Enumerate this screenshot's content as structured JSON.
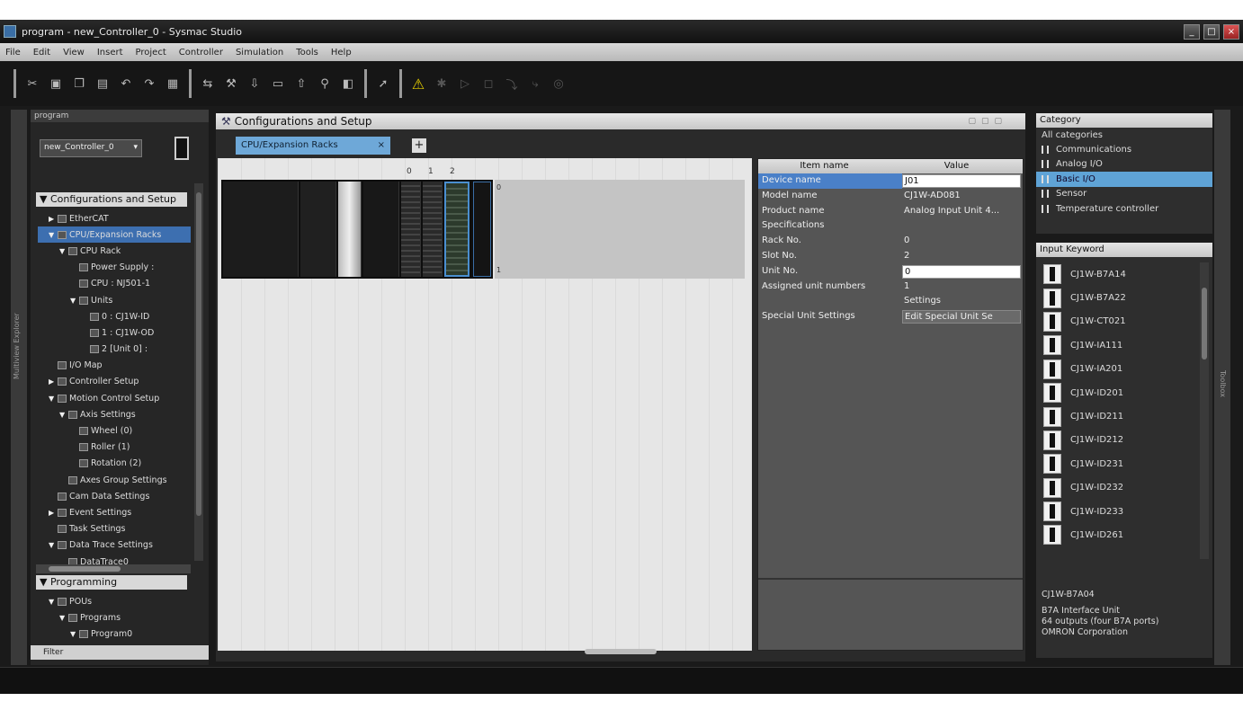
{
  "window": {
    "title": "program - new_Controller_0 - Sysmac Studio",
    "minimize": "_",
    "maximize": "□",
    "close": "×"
  },
  "menu": [
    "File",
    "Edit",
    "View",
    "Insert",
    "Project",
    "Controller",
    "Simulation",
    "Tools",
    "Help"
  ],
  "toolbar": {
    "icons": [
      "cut-icon",
      "save-icon",
      "copy-icon",
      "paste-icon",
      "undo-icon",
      "redo-icon",
      "build-icon",
      "online-icon",
      "wrench-icon",
      "transfer-icon",
      "window-icon",
      "transfer-from-icon",
      "search-icon",
      "compare-icon",
      "cursor-icon",
      "warning-icon",
      "simulate-icon",
      "run-icon",
      "stop-icon",
      "step-icon",
      "step-over-icon",
      "pause-icon"
    ],
    "warning_glyph": "⚠"
  },
  "left_strip_label": "Multiview Explorer",
  "right_strip_label": "Toolbox",
  "explorer": {
    "title": "program",
    "device": "new_Controller_0",
    "config_header": "Configurations and Setup",
    "tree": [
      {
        "level": 1,
        "arrow": "▶",
        "label": "EtherCAT"
      },
      {
        "level": 1,
        "arrow": "▼",
        "label": "CPU/Expansion Racks",
        "selected": true
      },
      {
        "level": 2,
        "arrow": "▼",
        "label": "CPU Rack"
      },
      {
        "level": 3,
        "arrow": "",
        "label": "Power Supply :"
      },
      {
        "level": 3,
        "arrow": "",
        "label": "CPU : NJ501-1"
      },
      {
        "level": 3,
        "arrow": "▼",
        "label": "Units"
      },
      {
        "level": 4,
        "arrow": "",
        "label": "0 : CJ1W-ID"
      },
      {
        "level": 4,
        "arrow": "",
        "label": "1 : CJ1W-OD"
      },
      {
        "level": 4,
        "arrow": "",
        "label": "2 [Unit 0] :"
      },
      {
        "level": 1,
        "arrow": "",
        "label": "I/O Map"
      },
      {
        "level": 1,
        "arrow": "▶",
        "label": "Controller Setup"
      },
      {
        "level": 1,
        "arrow": "▼",
        "label": "Motion Control Setup"
      },
      {
        "level": 2,
        "arrow": "▼",
        "label": "Axis Settings"
      },
      {
        "level": 3,
        "arrow": "",
        "label": "Wheel (0)"
      },
      {
        "level": 3,
        "arrow": "",
        "label": "Roller (1)"
      },
      {
        "level": 3,
        "arrow": "",
        "label": "Rotation (2)"
      },
      {
        "level": 2,
        "arrow": "",
        "label": "Axes Group Settings"
      },
      {
        "level": 1,
        "arrow": "",
        "label": "Cam Data Settings"
      },
      {
        "level": 1,
        "arrow": "▶",
        "label": "Event Settings"
      },
      {
        "level": 1,
        "arrow": "",
        "label": "Task Settings"
      },
      {
        "level": 1,
        "arrow": "▼",
        "label": "Data Trace Settings"
      },
      {
        "level": 2,
        "arrow": "",
        "label": "DataTrace0"
      }
    ],
    "prog_header": "Programming",
    "prog_tree": [
      {
        "level": 1,
        "arrow": "▼",
        "label": "POUs"
      },
      {
        "level": 2,
        "arrow": "▼",
        "label": "Programs"
      },
      {
        "level": 3,
        "arrow": "▼",
        "label": "Program0"
      }
    ],
    "filter": "Filter"
  },
  "editor": {
    "title": "Configurations and Setup",
    "tab": "CPU/Expansion Racks",
    "tab_close": "×",
    "tab_add": "+",
    "slot_numbers": [
      "0",
      "1",
      "2"
    ],
    "rack_number": "0",
    "rack_end": "1"
  },
  "properties": {
    "header_name": "Item name",
    "header_value": "Value",
    "rows": [
      {
        "name": "Device name",
        "value": "J01",
        "kind": "input",
        "selected": true
      },
      {
        "name": "Model name",
        "value": "CJ1W-AD081",
        "kind": "text"
      },
      {
        "name": "Product name",
        "value": "Analog Input Unit 4...",
        "kind": "text"
      },
      {
        "name": "Specifications",
        "value": "",
        "kind": "text"
      },
      {
        "name": "Rack No.",
        "value": "0",
        "kind": "text"
      },
      {
        "name": "Slot No.",
        "value": "2",
        "kind": "text"
      },
      {
        "name": "Unit No.",
        "value": "0",
        "kind": "input"
      },
      {
        "name": "Assigned unit numbers",
        "value": "1",
        "kind": "text"
      },
      {
        "name": "",
        "value": "Settings",
        "kind": "text"
      },
      {
        "name": "Special Unit Settings",
        "value": "Edit Special Unit Se",
        "kind": "btn"
      }
    ]
  },
  "category": {
    "title": "Category",
    "items": [
      {
        "label": "All categories",
        "icon": false
      },
      {
        "label": "Communications",
        "icon": true
      },
      {
        "label": "Analog I/O",
        "icon": true
      },
      {
        "label": "Basic I/O",
        "icon": true,
        "selected": true
      },
      {
        "label": "Sensor",
        "icon": true
      },
      {
        "label": "Temperature controller",
        "icon": true
      }
    ]
  },
  "units": {
    "title": "Input Keyword",
    "items": [
      "CJ1W-B7A14",
      "CJ1W-B7A22",
      "CJ1W-CT021",
      "CJ1W-IA111",
      "CJ1W-IA201",
      "CJ1W-ID201",
      "CJ1W-ID211",
      "CJ1W-ID212",
      "CJ1W-ID231",
      "CJ1W-ID232",
      "CJ1W-ID233",
      "CJ1W-ID261"
    ]
  },
  "unit_description": {
    "model": "CJ1W-B7A04",
    "lines": [
      "B7A Interface Unit",
      "64 outputs (four B7A ports)",
      "OMRON Corporation"
    ]
  }
}
